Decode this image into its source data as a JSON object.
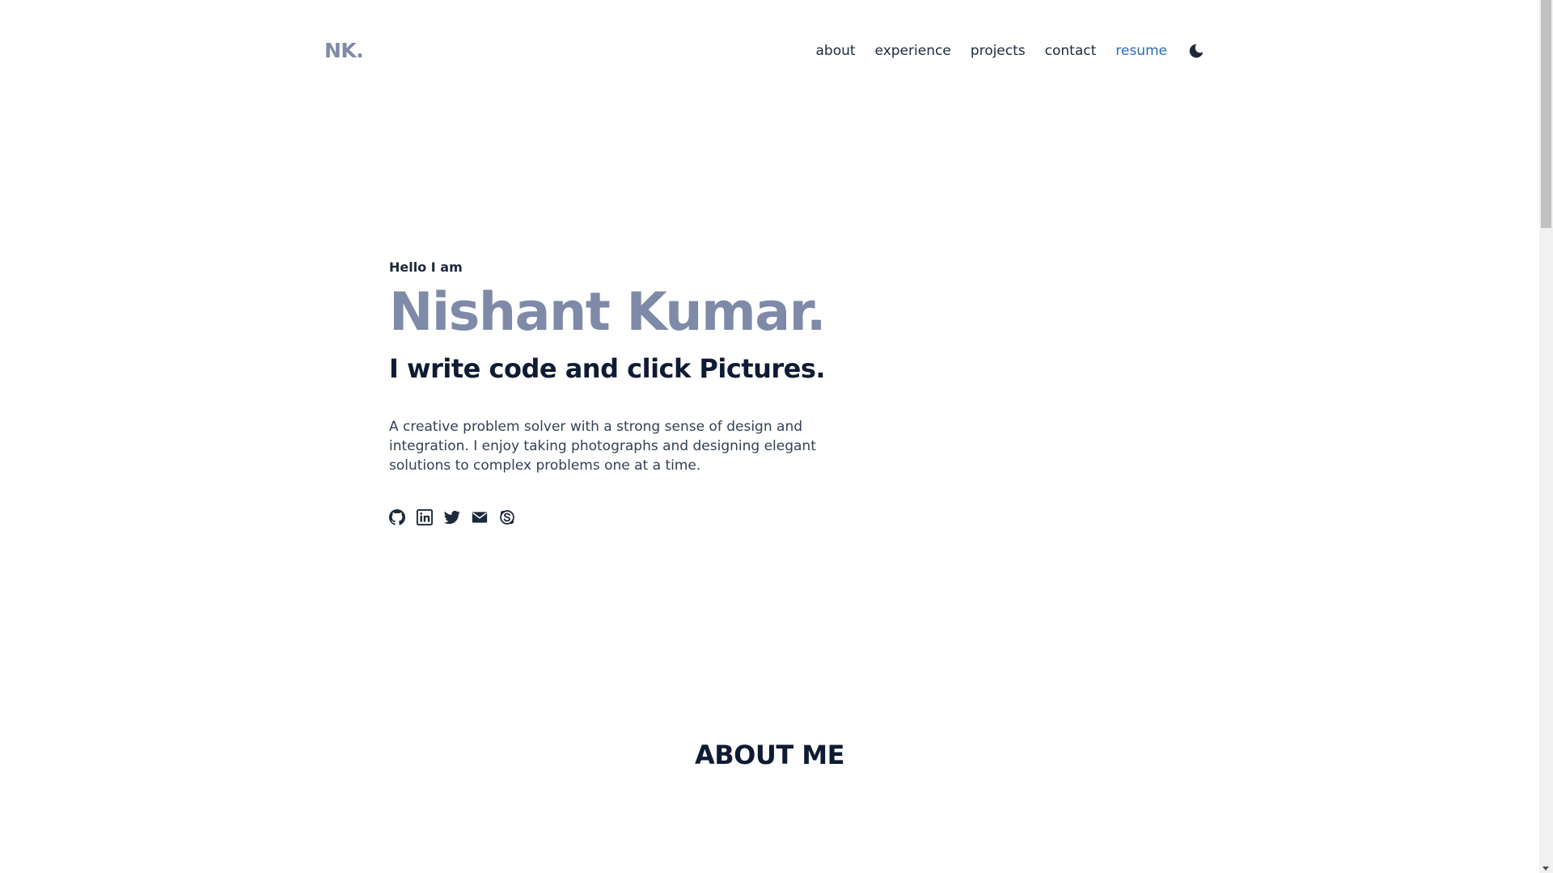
{
  "header": {
    "logo": "NK.",
    "nav": [
      {
        "label": "about",
        "name": "nav-about"
      },
      {
        "label": "experience",
        "name": "nav-experience"
      },
      {
        "label": "projects",
        "name": "nav-projects"
      },
      {
        "label": "contact",
        "name": "nav-contact"
      },
      {
        "label": "resume",
        "name": "nav-resume",
        "accent": true
      }
    ],
    "theme_toggle_icon": "moon-icon"
  },
  "hero": {
    "greeting": "Hello I am",
    "name": "Nishant Kumar.",
    "tagline": "I write code and click Pictures.",
    "bio": "A creative problem solver with a strong sense of design and integration. I enjoy taking photographs and designing elegant solutions to complex problems one at a time.",
    "socials": [
      "github-icon",
      "linkedin-icon",
      "twitter-icon",
      "email-icon",
      "skype-icon"
    ]
  },
  "about": {
    "title": "ABOUT ME"
  },
  "colors": {
    "accent": "#2b6cb0",
    "muted_name": "#7f8aa8",
    "text_dark": "#0f1b33",
    "text_body": "#334155"
  }
}
